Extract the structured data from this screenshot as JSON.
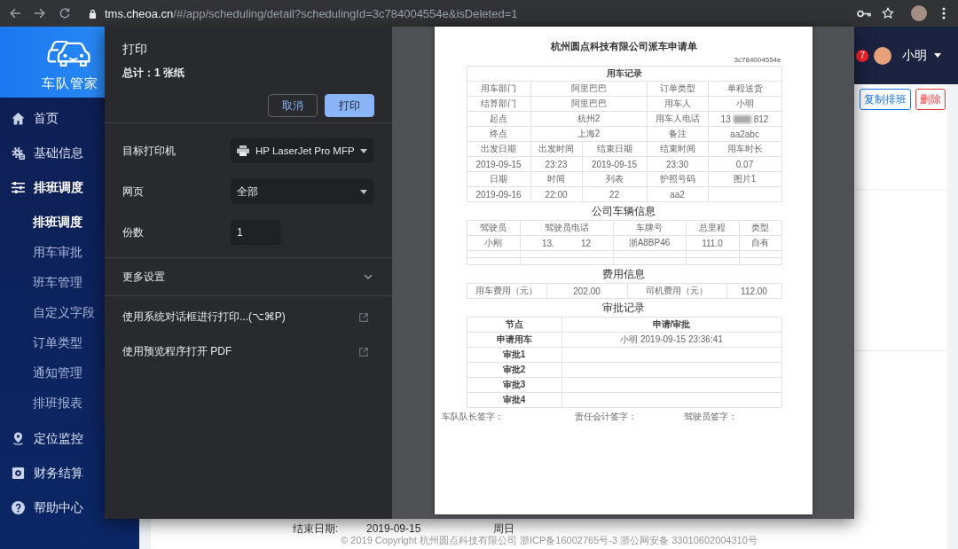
{
  "browser": {
    "url_host": "tms.cheoa.cn",
    "url_path": "/#/app/scheduling/detail?schedulingId=3c784004554e&isDeleted=1"
  },
  "sidebar": {
    "logo_text": "车队管家",
    "items": [
      {
        "label": "首页"
      },
      {
        "label": "基础信息"
      },
      {
        "label": "排班调度",
        "expanded": true,
        "children": [
          {
            "label": "排班调度",
            "selected": true
          },
          {
            "label": "用车审批",
            "selected": false
          },
          {
            "label": "班车管理",
            "selected": false
          },
          {
            "label": "自定义字段",
            "selected": false
          },
          {
            "label": "订单类型",
            "selected": false
          },
          {
            "label": "通知管理",
            "selected": false
          },
          {
            "label": "排班报表",
            "selected": false
          }
        ]
      },
      {
        "label": "定位监控"
      },
      {
        "label": "财务结算"
      },
      {
        "label": "帮助中心"
      }
    ]
  },
  "header": {
    "badge": "7",
    "user_name": "小明"
  },
  "actions": [
    {
      "label": "复制排班",
      "kind": "copy"
    },
    {
      "label": "删除",
      "kind": "delete"
    }
  ],
  "detail": {
    "end_date_label": "结束日期:",
    "end_date": "2019-09-15",
    "weekday": "周日"
  },
  "footer": {
    "copyright": "© 2019 Copyright 杭州圆点科技有限公司 浙ICP备16002765号-3 浙公网安备 33010602004310号"
  },
  "print_dialog": {
    "title": "打印",
    "summary": "总计：1 张纸",
    "buttons": [
      {
        "label": "取消",
        "kind": "cancel"
      },
      {
        "label": "打印",
        "kind": "confirm"
      }
    ],
    "settings": [
      {
        "label": "目标打印机",
        "kind": "printer",
        "value": "HP LaserJet Pro MFP"
      },
      {
        "label": "网页",
        "kind": "pages",
        "value": "全部"
      },
      {
        "label": "份数",
        "kind": "copies",
        "value": "1"
      }
    ],
    "more_settings": {
      "label": "更多设置",
      "expanded": false
    },
    "options": [
      {
        "label": "使用系统对话框进行打印...(⌥⌘P)"
      },
      {
        "label": "使用预览程序打开 PDF"
      }
    ]
  },
  "document": {
    "title": "杭州圆点科技有限公司派车申请单",
    "doc_id": "3c784004554e",
    "record": {
      "caption": "用车记录",
      "rows": [
        {
          "kind": "pairs",
          "cells": [
            "用车部门",
            "阿里巴巴",
            "订单类型",
            "单程送货"
          ]
        },
        {
          "kind": "pairs",
          "cells": [
            "结算部门",
            "阿里巴巴",
            "用车人",
            "小明"
          ]
        },
        {
          "kind": "pairs",
          "cells": [
            "起点",
            "杭州2",
            "用车人电话",
            {
              "parts": [
                "13",
                "812"
              ],
              "redacted": true
            }
          ]
        },
        {
          "kind": "pairs",
          "cells": [
            "终点",
            "上海2",
            "备注",
            "aa2abc"
          ]
        },
        {
          "kind": "grid",
          "cells": [
            "出发日期",
            "出发时间",
            "结束日期",
            "结束时间",
            "用车时长"
          ]
        },
        {
          "kind": "grid",
          "cells": [
            "2019-09-15",
            "23:23",
            "2019-09-15",
            "23:30",
            "0.07"
          ]
        },
        {
          "kind": "grid",
          "cells": [
            "日期",
            "时间",
            "列表",
            "护照号码",
            "图片1"
          ]
        },
        {
          "kind": "grid",
          "cells": [
            "2019-09-16",
            "22:00",
            "22",
            "aa2"
          ]
        }
      ]
    },
    "vehicles": {
      "heading": "公司车辆信息",
      "columns": [
        "驾驶员",
        "驾驶员电话",
        "车牌号",
        "总里程",
        "类型"
      ],
      "rows": [
        [
          "小刚",
          {
            "parts": [
              "13.",
              "12"
            ],
            "redacted": false
          },
          "浙A8BP46",
          "111.0",
          "自有"
        ]
      ]
    },
    "fees": {
      "heading": "费用信息",
      "cells": [
        "用车费用（元）",
        "202.00",
        "司机费用（元）",
        "112.00"
      ]
    },
    "approvals": {
      "heading": "审批记录",
      "columns": [
        "节点",
        "申请/审批"
      ],
      "rows": [
        [
          "申请用车",
          "小明 2019-09-15 23:36:41"
        ],
        [
          "审批1"
        ],
        [
          "审批2"
        ],
        [
          "审批3"
        ],
        [
          "审批4"
        ]
      ]
    },
    "signatures": [
      "车队队长签字：",
      "责任会计签字：",
      "驾驶员签字："
    ]
  }
}
